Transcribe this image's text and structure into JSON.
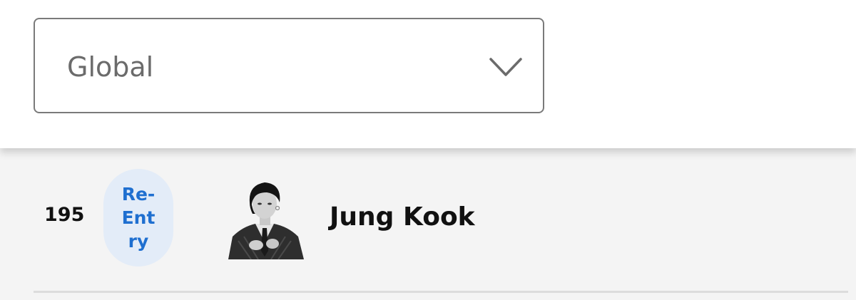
{
  "region_select": {
    "value": "Global",
    "icon": "chevron-down-icon"
  },
  "chart_entry": {
    "rank": "195",
    "badge_label": "Re-\nEnt\nry",
    "artist_name": "Jung Kook",
    "avatar_icon": "artist-photo"
  },
  "colors": {
    "badge_bg": "#e3ecf8",
    "badge_text": "#1f6fd0",
    "list_bg": "#f4f4f4",
    "select_border": "#7a7a7a"
  }
}
